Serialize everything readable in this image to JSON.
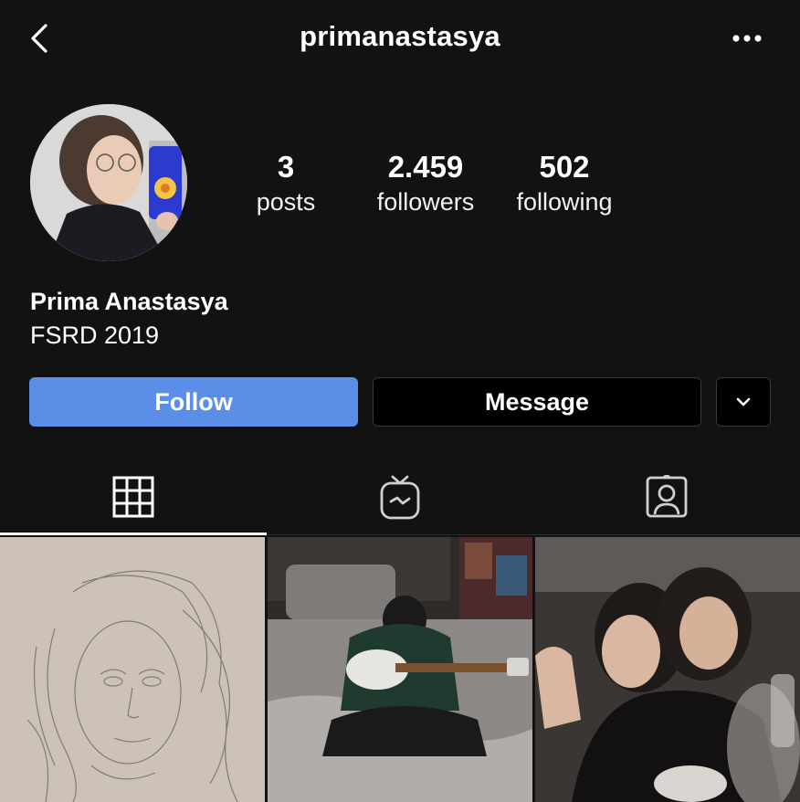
{
  "header": {
    "username": "primanastasya",
    "back_icon": "chevron-left-icon",
    "more_icon": "more-horizontal-icon"
  },
  "profile": {
    "stats": [
      {
        "value": "3",
        "label": "posts"
      },
      {
        "value": "2.459",
        "label": "followers"
      },
      {
        "value": "502",
        "label": "following"
      }
    ],
    "full_name": "Prima Anastasya",
    "bio": "FSRD 2019"
  },
  "actions": {
    "follow_label": "Follow",
    "message_label": "Message",
    "dropdown_icon": "chevron-down-icon"
  },
  "tabs": [
    {
      "icon": "grid-icon",
      "active": true
    },
    {
      "icon": "igtv-icon",
      "active": false
    },
    {
      "icon": "tagged-icon",
      "active": false
    }
  ],
  "colors": {
    "background": "#121212",
    "follow_button": "#5b8ee6",
    "button_dark": "#000000"
  }
}
